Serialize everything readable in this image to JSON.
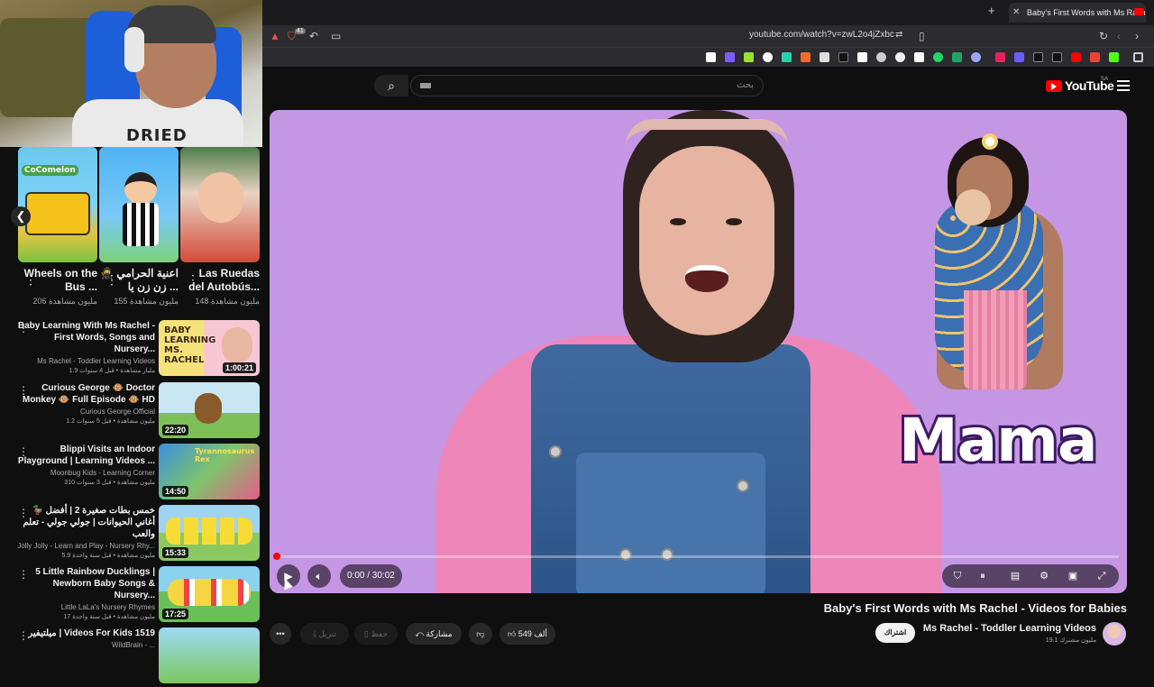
{
  "browser": {
    "tab_title": "Baby's First Words with Ms Rache...",
    "tab_close": "✕",
    "new_tab": "+",
    "url": "youtube.com/watch?v=zwL2o4jZxbc",
    "shield_badge": "41"
  },
  "webcam": {
    "shirt_text": "DRIED"
  },
  "youtube": {
    "logo_text": "YouTube",
    "region": "SA",
    "search_placeholder": "بحث"
  },
  "shorts": [
    {
      "title": "Wheels on the Bus ...",
      "views": "206 مليون مشاهدة"
    },
    {
      "title": "اعنية الحرامي 🥷 زن زن يا ...",
      "views": "155 مليون مشاهدة"
    },
    {
      "title": "Las Ruedas del Autobús...",
      "views": "148 مليون مشاهدة"
    }
  ],
  "recommendations": [
    {
      "title": "Baby Learning With Ms Rachel - First Words, Songs and Nursery...",
      "channel": "Ms Rachel - Toddler Learning Videos",
      "meta": "1.9 مليار مشاهدة • قبل 4 سنوات",
      "duration": "1:00:21",
      "thumb_text": "BABY LEARNING MS. RACHEL"
    },
    {
      "title": "Curious George 🐵 Doctor Monkey 🐵 Full Episode 🐵 HD",
      "channel": "Curious George Official",
      "meta": "1.2 مليون مشاهدة • قبل 5 سنوات",
      "duration": "22:20",
      "thumb_text": ""
    },
    {
      "title": "Blippi Visits an Indoor Playground | Learning Videos ...",
      "channel": "Moonbug Kids - Learning Corner",
      "meta": "310 مليون مشاهدة • قبل 3 سنوات",
      "duration": "14:50",
      "thumb_text": "Tyrannosaurus Rex"
    },
    {
      "title": "🦆 خمس بطات صغيرة 2 | أفضل أغاني الحيوانات | جولي جولي - تعلم والعب",
      "channel": "Jolly Jolly - Learn and Play - Nursery Rhy...",
      "meta": "5.9 مليون مشاهدة • قبل سنة واحدة",
      "duration": "15:33",
      "thumb_text": ""
    },
    {
      "title": "5 Little Rainbow Ducklings | Newborn Baby Songs & Nursery...",
      "channel": "Little LaLa's Nursery Rhymes",
      "meta": "17 مليون مشاهدة • قبل سنة واحدة",
      "duration": "17:25",
      "thumb_text": ""
    },
    {
      "title": "ميلتيفير | Videos For Kids 1519",
      "channel": "WildBrain - ...",
      "meta": "",
      "duration": "",
      "thumb_text": ""
    }
  ],
  "player": {
    "overlay_word": "Mama",
    "time": "0:00 / 30:02",
    "progress_fraction": 0
  },
  "video": {
    "title": "Baby's First Words with Ms Rachel - Videos for Babies",
    "channel": "Ms Rachel - Toddler Learning Videos",
    "subscribers": "19.1 مليون مشترك",
    "subscribe": "اشتراك",
    "likes": "549 ألف",
    "share": "مشاركة",
    "save": "حفظ",
    "download": "تنزيل",
    "more": "•••"
  },
  "colors": {
    "player_bg": "#c596e4",
    "yt_red": "#ff0000",
    "accent_purple": "#3c1a62"
  }
}
